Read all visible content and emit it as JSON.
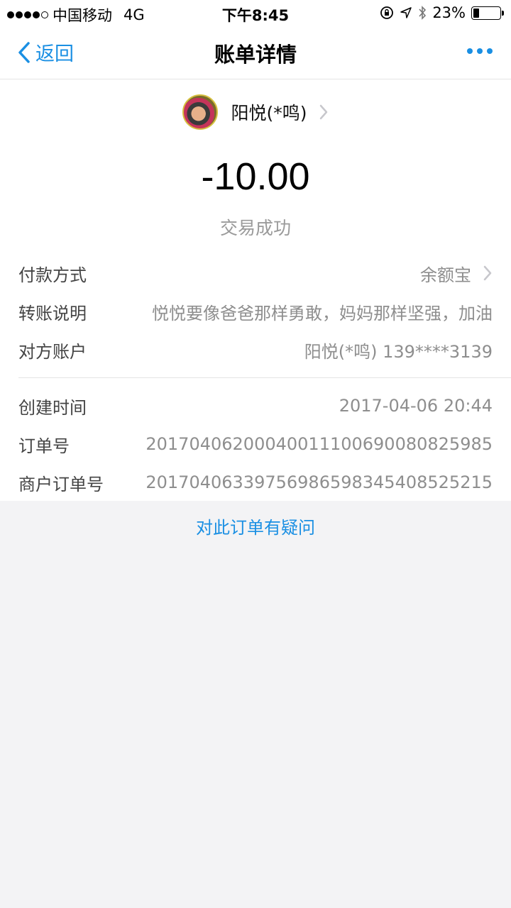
{
  "status_bar": {
    "carrier": "中国移动",
    "network": "4G",
    "time": "下午8:45",
    "battery_percent": "23%",
    "battery_level": 0.23
  },
  "nav": {
    "back_label": "返回",
    "title": "账单详情"
  },
  "payee": {
    "name": "阳悦(*鸣)"
  },
  "transaction": {
    "amount": "-10.00",
    "status": "交易成功"
  },
  "details": [
    {
      "label": "付款方式",
      "value": "余额宝"
    },
    {
      "label": "转账说明",
      "value": "悦悦要像爸爸那样勇敢，妈妈那样坚强，加油"
    },
    {
      "label": "对方账户",
      "value": "阳悦(*鸣) 139****3139"
    }
  ],
  "order": [
    {
      "label": "创建时间",
      "value": "2017-04-06 20:44"
    },
    {
      "label": "订单号",
      "value": "20170406200040011100690080825985"
    },
    {
      "label": "商户订单号",
      "value": "20170406339756986598345408525215"
    }
  ],
  "footer": {
    "question_link": "对此订单有疑问"
  },
  "colors": {
    "accent": "#1a8fe3",
    "muted_text": "#8e8e8e",
    "background": "#f3f3f5"
  }
}
